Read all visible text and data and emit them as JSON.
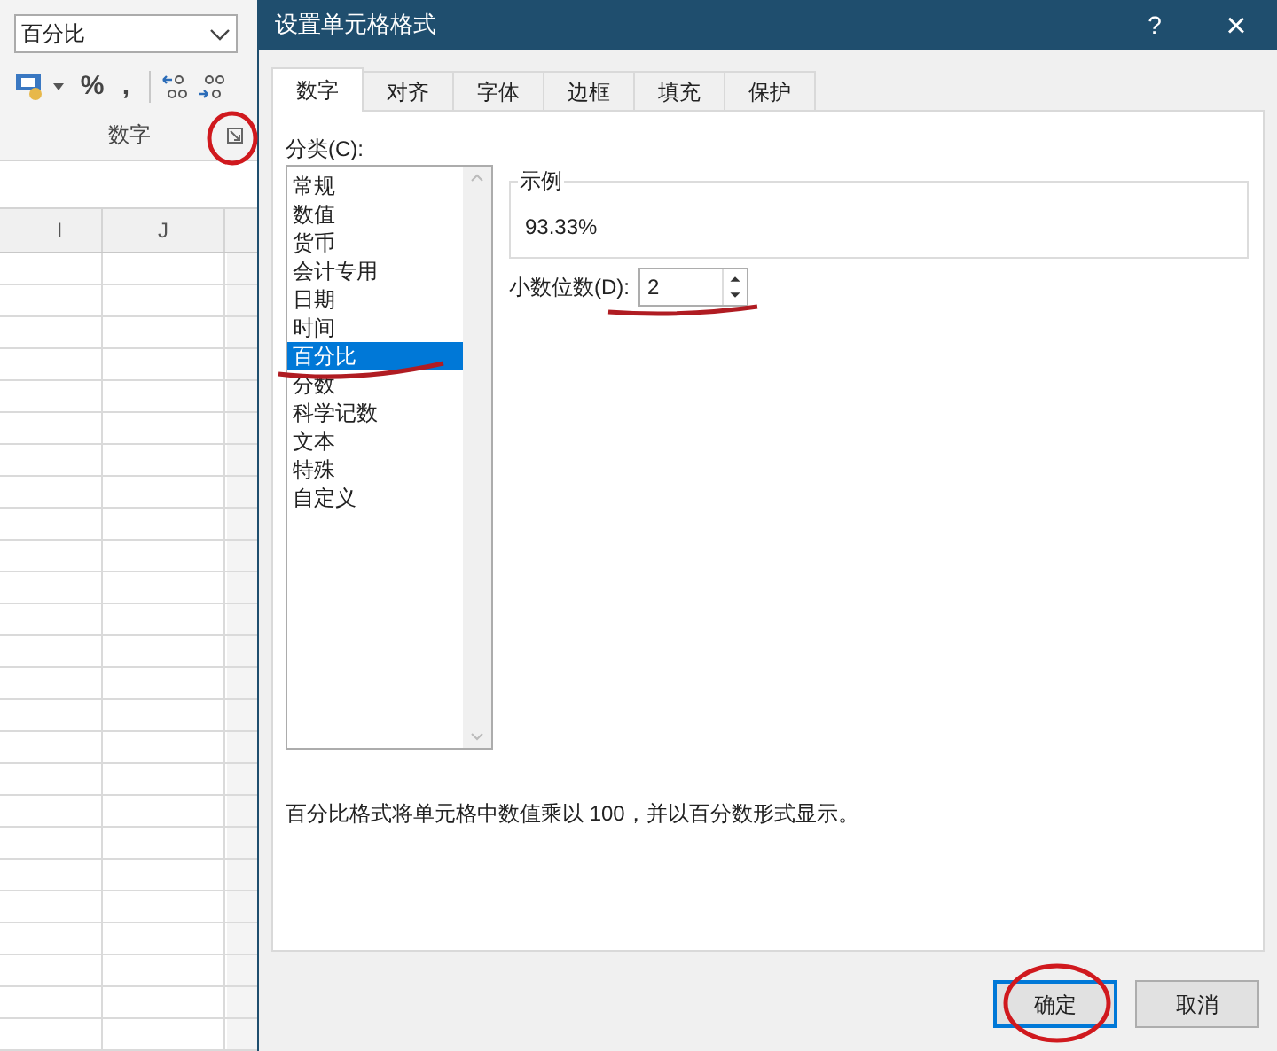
{
  "ribbon": {
    "format_dropdown": {
      "value": "百分比"
    },
    "percent_button": "%",
    "comma_button": ",",
    "group_label": "数字"
  },
  "sheet": {
    "columns": [
      "I",
      "J"
    ]
  },
  "dialog": {
    "title": "设置单元格格式",
    "help": "?",
    "close": "×",
    "tabs": [
      {
        "label": "数字",
        "selected": true
      },
      {
        "label": "对齐",
        "selected": false
      },
      {
        "label": "字体",
        "selected": false
      },
      {
        "label": "边框",
        "selected": false
      },
      {
        "label": "填充",
        "selected": false
      },
      {
        "label": "保护",
        "selected": false
      }
    ],
    "category_label": "分类(C):",
    "categories": [
      {
        "label": "常规",
        "selected": false
      },
      {
        "label": "数值",
        "selected": false
      },
      {
        "label": "货币",
        "selected": false
      },
      {
        "label": "会计专用",
        "selected": false
      },
      {
        "label": "日期",
        "selected": false
      },
      {
        "label": "时间",
        "selected": false
      },
      {
        "label": "百分比",
        "selected": true
      },
      {
        "label": "分数",
        "selected": false
      },
      {
        "label": "科学记数",
        "selected": false
      },
      {
        "label": "文本",
        "selected": false
      },
      {
        "label": "特殊",
        "selected": false
      },
      {
        "label": "自定义",
        "selected": false
      }
    ],
    "sample": {
      "label": "示例",
      "value": "93.33%"
    },
    "decimal_places": {
      "label": "小数位数(D):",
      "value": "2"
    },
    "description": "百分比格式将单元格中数值乘以 100，并以百分数形式显示。",
    "buttons": [
      {
        "label": "确定",
        "default": true
      },
      {
        "label": "取消",
        "default": false
      }
    ]
  }
}
